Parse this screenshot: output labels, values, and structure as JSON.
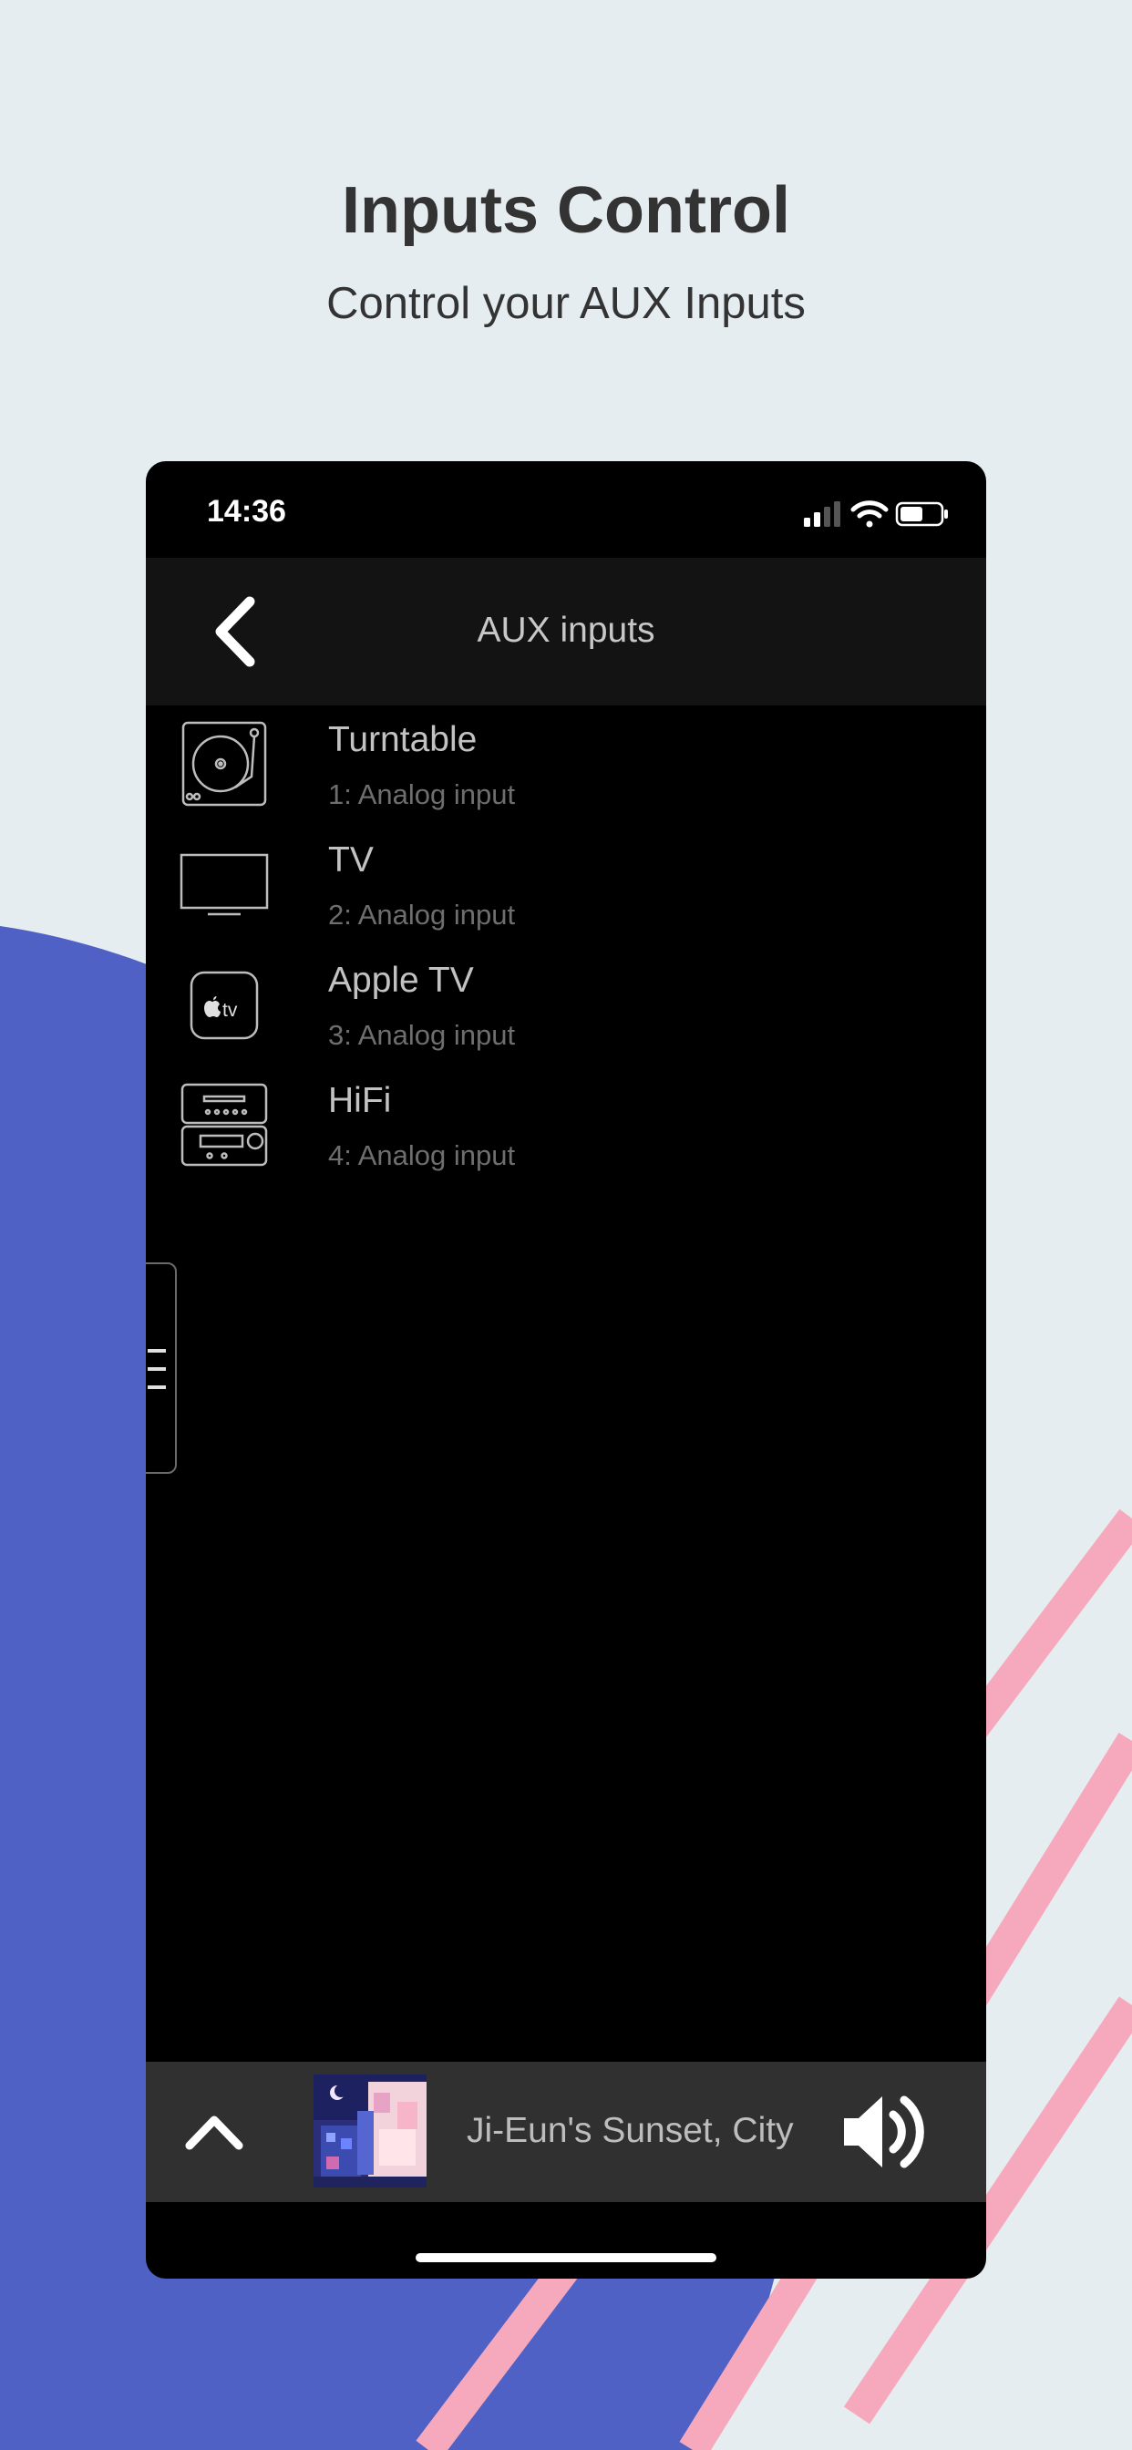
{
  "marketing": {
    "headline": "Inputs Control",
    "subheadline": "Control your AUX Inputs"
  },
  "status_bar": {
    "time": "14:36",
    "icons": [
      "cellular-signal-icon",
      "wifi-icon",
      "battery-icon"
    ]
  },
  "nav": {
    "title": "AUX inputs",
    "back_icon": "chevron-left-icon"
  },
  "inputs": [
    {
      "name": "Turntable",
      "description": "1: Analog input",
      "icon": "turntable-icon"
    },
    {
      "name": "TV",
      "description": "2: Analog input",
      "icon": "tv-icon"
    },
    {
      "name": "Apple TV",
      "description": "3: Analog input",
      "icon": "apple-tv-icon",
      "icon_text": "tv"
    },
    {
      "name": "HiFi",
      "description": "4: Analog input",
      "icon": "hifi-icon"
    }
  ],
  "side_menu": {
    "icon": "menu-icon"
  },
  "player": {
    "track_title": "Ji-Eun's Sunset, City",
    "expand_icon": "chevron-up-icon",
    "volume_icon": "speaker-volume-icon"
  },
  "colors": {
    "background": "#e6edf0",
    "blob": "#4f61c4",
    "stripe": "#f6a9bd",
    "phone": "#000000",
    "nav_bar": "#131313",
    "player_bar": "#303030"
  }
}
